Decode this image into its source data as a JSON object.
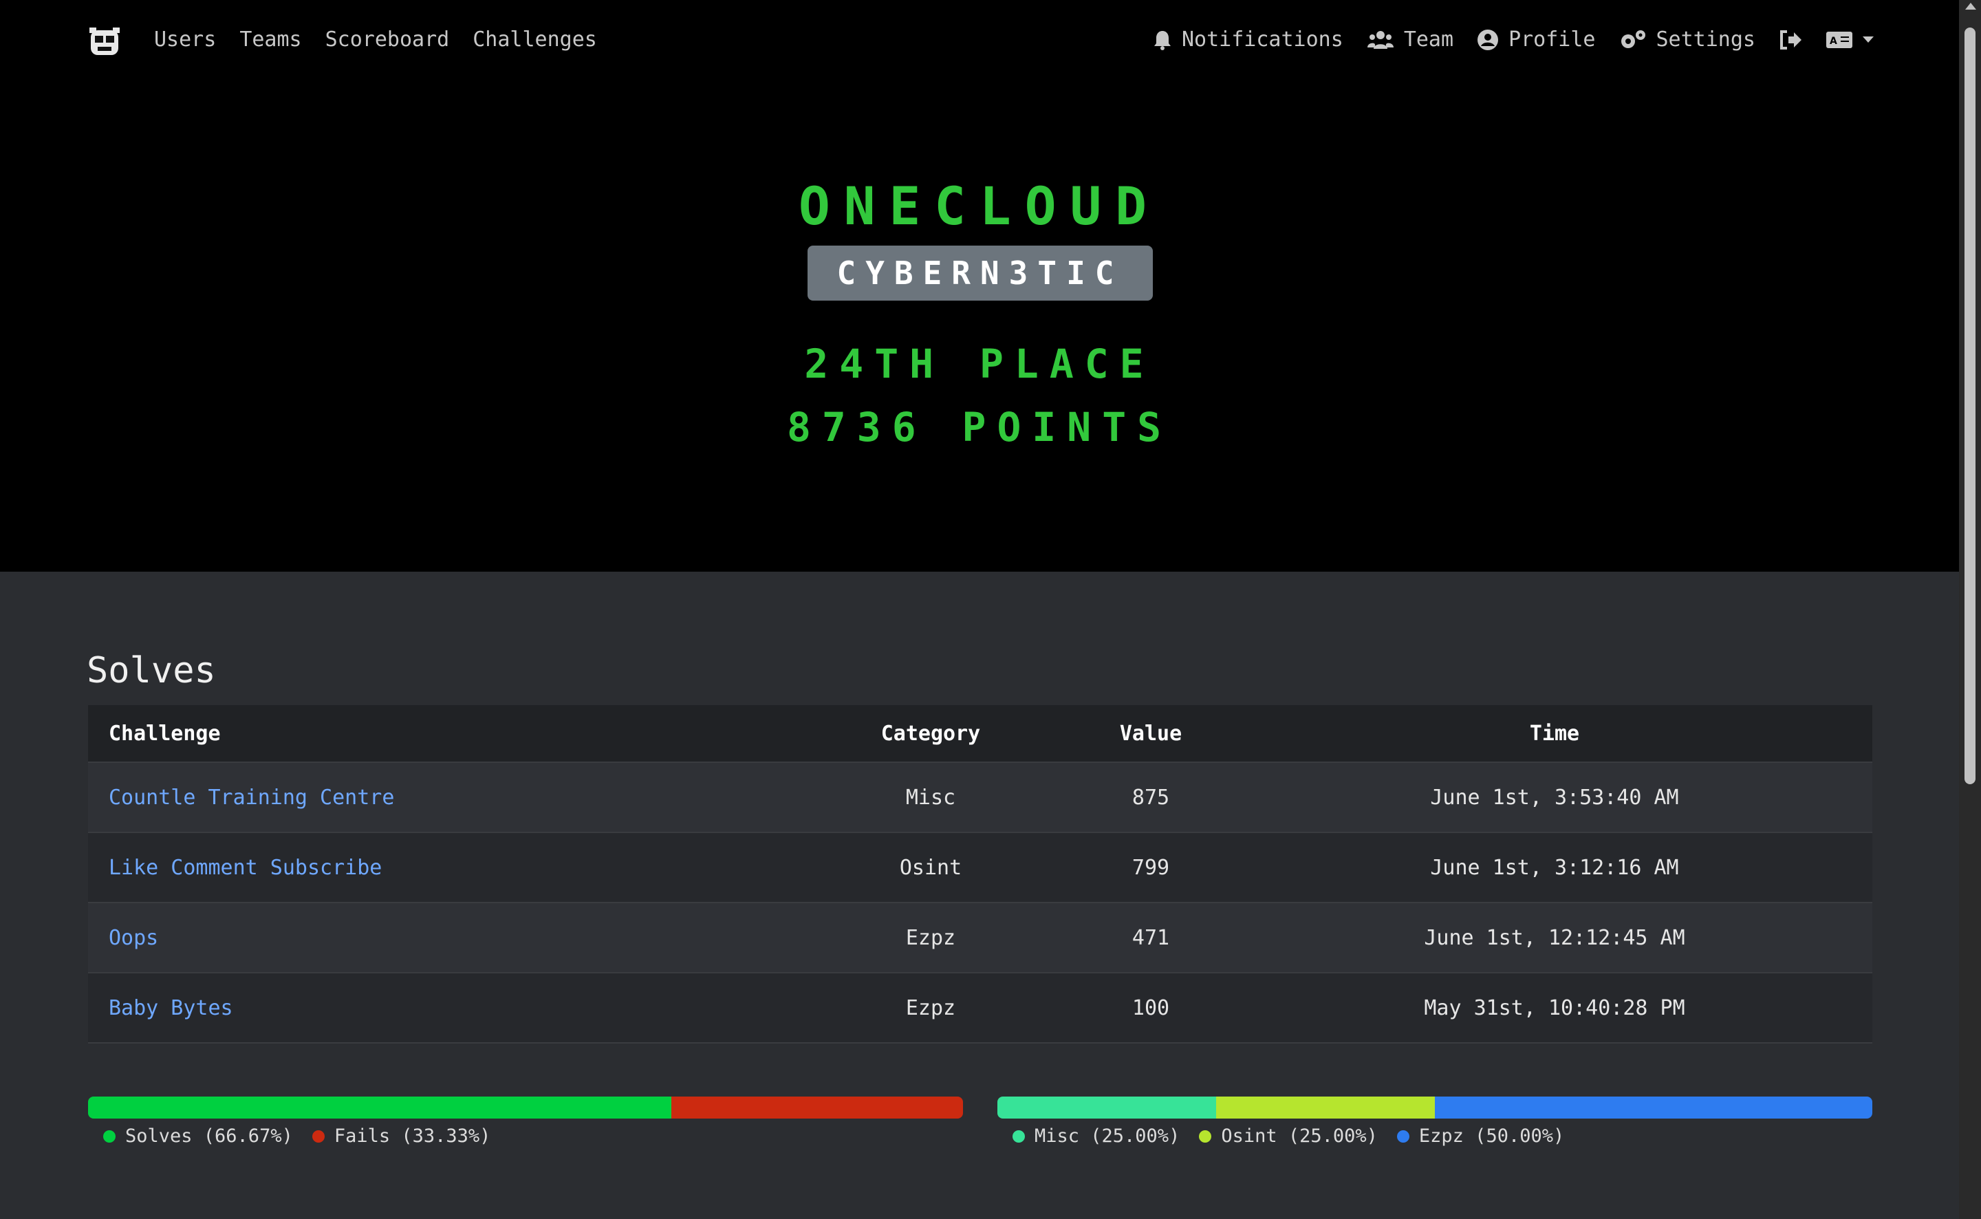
{
  "nav": {
    "left": [
      "Users",
      "Teams",
      "Scoreboard",
      "Challenges"
    ],
    "notifications": "Notifications",
    "team": "Team",
    "profile": "Profile",
    "settings": "Settings"
  },
  "hero": {
    "team_name": "ONECLOUD",
    "affiliation": "CYBERN3TIC",
    "place": "24TH PLACE",
    "points": "8736 POINTS"
  },
  "solves": {
    "title": "Solves",
    "headers": [
      "Challenge",
      "Category",
      "Value",
      "Time"
    ],
    "rows": [
      {
        "challenge": "Countle Training Centre",
        "category": "Misc",
        "value": "875",
        "time": "June 1st, 3:53:40 AM"
      },
      {
        "challenge": "Like Comment Subscribe",
        "category": "Osint",
        "value": "799",
        "time": "June 1st, 3:12:16 AM"
      },
      {
        "challenge": "Oops",
        "category": "Ezpz",
        "value": "471",
        "time": "June 1st, 12:12:45 AM"
      },
      {
        "challenge": "Baby Bytes",
        "category": "Ezpz",
        "value": "100",
        "time": "May 31st, 10:40:28 PM"
      }
    ]
  },
  "solve_bar": {
    "segments": [
      {
        "label": "Solves (66.67%)",
        "fraction": 0.6667,
        "color": "#00d040"
      },
      {
        "label": "Fails (33.33%)",
        "fraction": 0.3333,
        "color": "#cc2a10"
      }
    ]
  },
  "category_bar": {
    "segments": [
      {
        "label": "Misc (25.00%)",
        "fraction": 0.25,
        "color": "#37e398"
      },
      {
        "label": "Osint (25.00%)",
        "fraction": 0.25,
        "color": "#b6e52e"
      },
      {
        "label": "Ezpz (50.00%)",
        "fraction": 0.5,
        "color": "#2e7cf0"
      }
    ]
  }
}
